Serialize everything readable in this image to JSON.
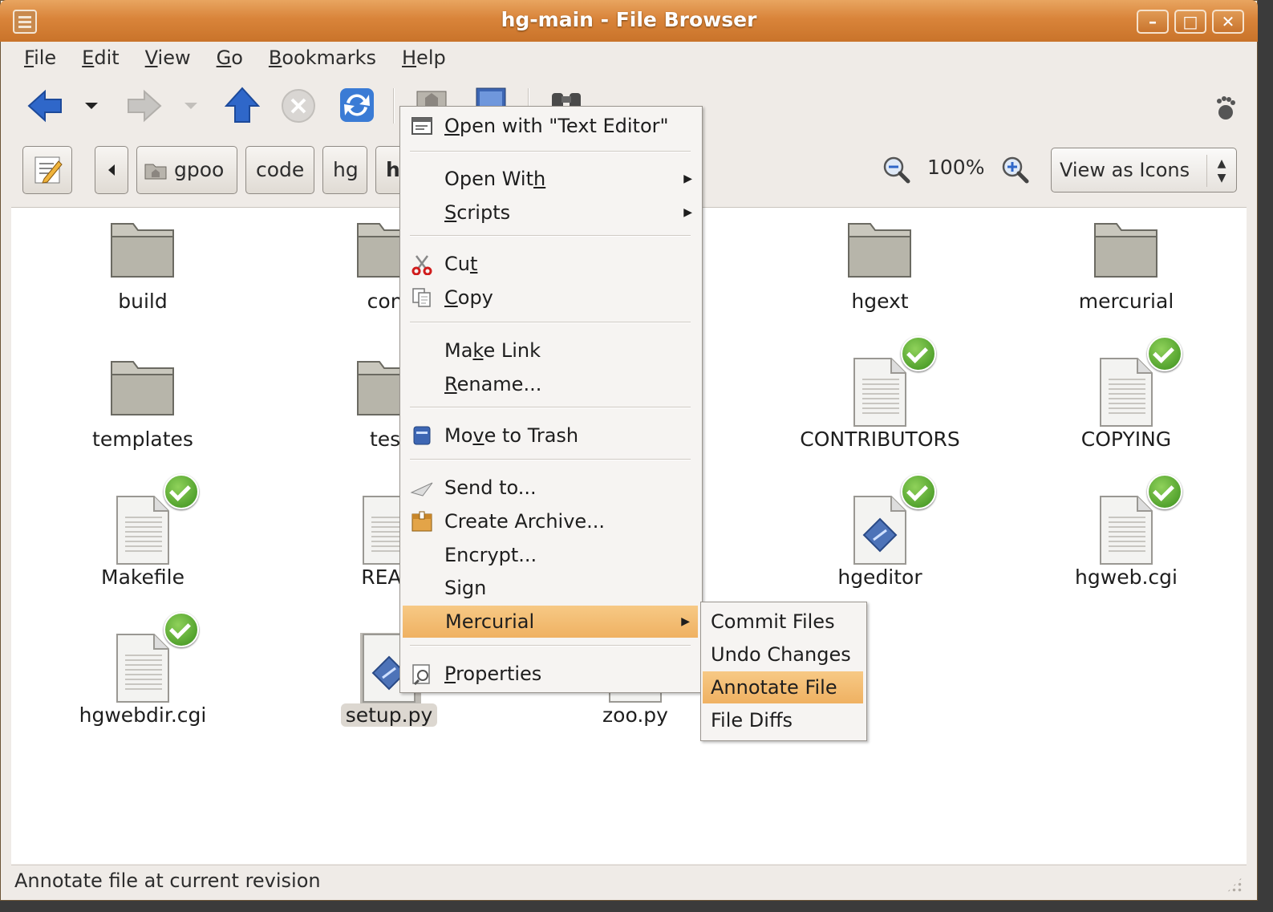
{
  "window": {
    "title": "hg-main - File Browser"
  },
  "menubar": [
    {
      "pre": "",
      "ul": "F",
      "post": "ile"
    },
    {
      "pre": "",
      "ul": "E",
      "post": "dit"
    },
    {
      "pre": "",
      "ul": "V",
      "post": "iew"
    },
    {
      "pre": "",
      "ul": "G",
      "post": "o"
    },
    {
      "pre": "",
      "ul": "B",
      "post": "ookmarks"
    },
    {
      "pre": "",
      "ul": "H",
      "post": "elp"
    }
  ],
  "location": {
    "crumbs": [
      "gpoo",
      "code",
      "hg",
      "h"
    ],
    "zoom": "100%",
    "view_mode": "View as Icons"
  },
  "files": [
    {
      "name": "build",
      "kind": "folder",
      "check": false
    },
    {
      "name": "cont",
      "kind": "folder",
      "check": false
    },
    {
      "name": "hgext",
      "kind": "folder",
      "check": false
    },
    {
      "name": "mercurial",
      "kind": "folder",
      "check": false
    },
    {
      "name": "templates",
      "kind": "folder",
      "check": false
    },
    {
      "name": "test",
      "kind": "folder",
      "check": false
    },
    {
      "name": "CONTRIBUTORS",
      "kind": "doc",
      "check": true
    },
    {
      "name": "COPYING",
      "kind": "doc",
      "check": true
    },
    {
      "name": "Makefile",
      "kind": "doc",
      "check": true
    },
    {
      "name": "READ",
      "kind": "doc",
      "check": false
    },
    {
      "name": "hgeditor",
      "kind": "script",
      "check": true
    },
    {
      "name": "hgweb.cgi",
      "kind": "doc",
      "check": true
    },
    {
      "name": "hgwebdir.cgi",
      "kind": "doc",
      "check": true
    },
    {
      "name": "setup.py",
      "kind": "script",
      "check": false
    },
    {
      "name": "zoo.py",
      "kind": "doc",
      "check": false
    }
  ],
  "context_menu": {
    "items": [
      {
        "pre": "",
        "ul": "O",
        "post": "pen with \"Text Editor\"",
        "icon": "text-editor-icon",
        "sub": false
      },
      {
        "pre": "Open Wit",
        "ul": "h",
        "post": "",
        "icon": "",
        "sub": true
      },
      {
        "pre": "",
        "ul": "S",
        "post": "cripts",
        "icon": "",
        "sub": true
      },
      {
        "pre": "Cu",
        "ul": "t",
        "post": "",
        "icon": "scissors-icon",
        "sub": false
      },
      {
        "pre": "",
        "ul": "C",
        "post": "opy",
        "icon": "copy-icon",
        "sub": false
      },
      {
        "pre": "Ma",
        "ul": "k",
        "post": "e Link",
        "icon": "",
        "sub": false
      },
      {
        "pre": "",
        "ul": "R",
        "post": "ename...",
        "icon": "",
        "sub": false
      },
      {
        "pre": "Mo",
        "ul": "v",
        "post": "e to Trash",
        "icon": "trash-icon",
        "sub": false
      },
      {
        "pre": "Send to...",
        "ul": "",
        "post": "",
        "icon": "send-icon",
        "sub": false
      },
      {
        "pre": "Create Archive...",
        "ul": "",
        "post": "",
        "icon": "archive-icon",
        "sub": false
      },
      {
        "pre": "Encrypt...",
        "ul": "",
        "post": "",
        "icon": "",
        "sub": false
      },
      {
        "pre": "Sign",
        "ul": "",
        "post": "",
        "icon": "",
        "sub": false
      },
      {
        "pre": "Mercurial",
        "ul": "",
        "post": "",
        "icon": "",
        "sub": true
      },
      {
        "pre": "",
        "ul": "P",
        "post": "roperties",
        "icon": "properties-icon",
        "sub": false
      }
    ],
    "mercurial_submenu": [
      "Commit Files",
      "Undo Changes",
      "Annotate File",
      "File Diffs"
    ],
    "highlighted": "Mercurial",
    "sub_highlighted": "Annotate File"
  },
  "statusbar": {
    "text": "Annotate file at current revision"
  },
  "colors": {
    "titlebar": "#d9843a",
    "highlight": "#f2b86c",
    "nav_blue": "#2f67c9"
  }
}
